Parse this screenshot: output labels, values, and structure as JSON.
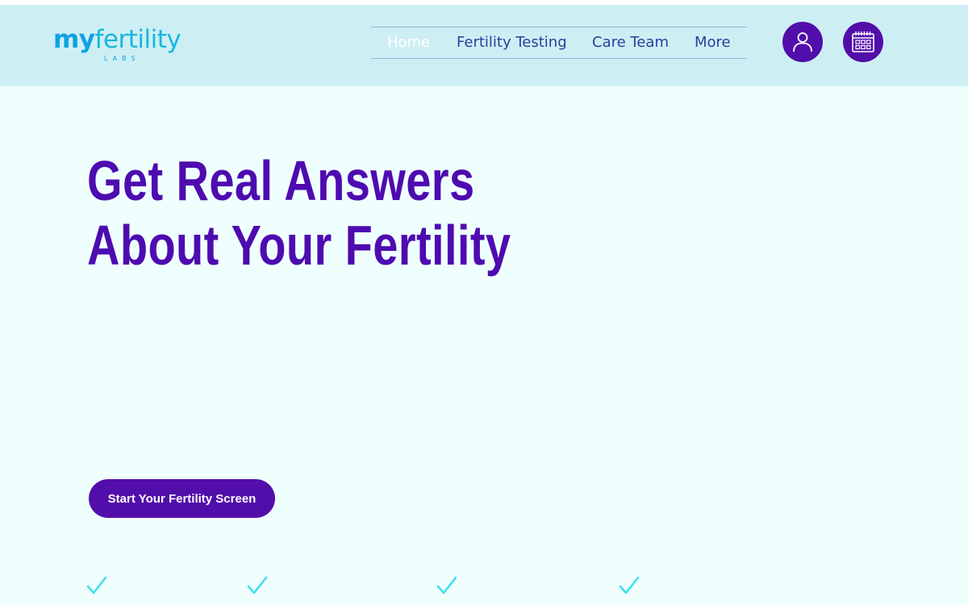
{
  "header": {
    "logo": {
      "word_my": "my",
      "word_rest": "fertility",
      "sub": "LABS"
    },
    "nav": {
      "items": [
        {
          "label": "Home",
          "active": true
        },
        {
          "label": "Fertility Testing",
          "active": false
        },
        {
          "label": "Care Team",
          "active": false
        },
        {
          "label": "More",
          "active": false
        }
      ]
    },
    "icons": {
      "account": "user-icon",
      "booking": "calendar-icon"
    }
  },
  "hero": {
    "title_line1": "Get Real Answers",
    "title_line2": "About Your Fertility",
    "cta_label": "Start Your Fertility Screen"
  },
  "features": {
    "check_icon": "checkmark-icon",
    "count_visible": 4
  },
  "colors": {
    "brand_purple": "#520eaa",
    "header_bg": "#cdeff4",
    "page_bg": "#effffe",
    "nav_text": "#2c3d9b",
    "logo_blue": "#0fa2e2",
    "check_cyan": "#3ee0f0"
  }
}
